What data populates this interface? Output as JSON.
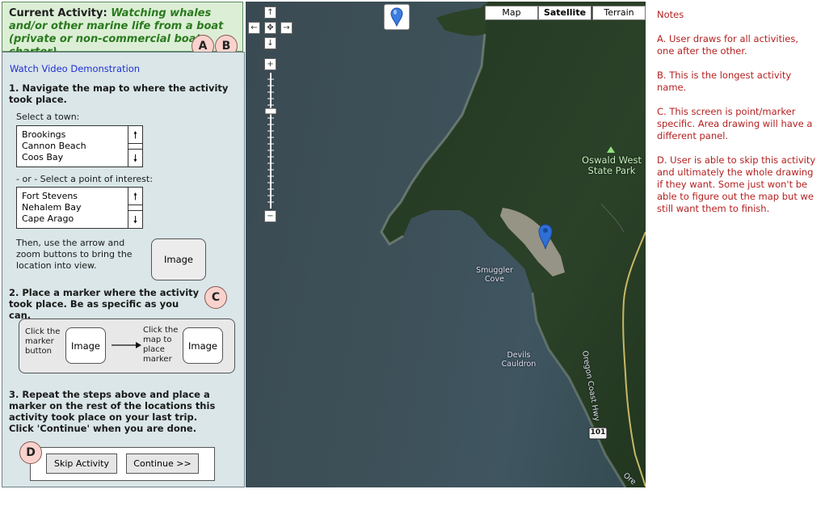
{
  "header": {
    "prefix": "Current Activity:",
    "activity_name": "Watching whales and/or other marine life from a boat (private or non-commercial boat, charter)"
  },
  "badges": {
    "a": "A",
    "b": "B",
    "c": "C",
    "d": "D"
  },
  "panel": {
    "video_link": "Watch Video Demonstration",
    "step1_title": "1. Navigate the map to where the activity took place.",
    "town_label": "Select a town:",
    "towns": [
      "Brookings",
      "Cannon Beach",
      "Coos Bay"
    ],
    "poi_label": "- or - Select a point of interest:",
    "points_of_interest": [
      "Fort Stevens",
      "Nehalem Bay",
      "Cape Arago"
    ],
    "arrow_text": "Then, use the arrow and zoom buttons to bring the location into view.",
    "image_label": "Image",
    "step2_title": "2. Place a marker where the activity took place.  Be as specific as you can.",
    "flow_text_1": "Click the marker button",
    "flow_text_2": "Click the map to place marker",
    "step3_title": "3.  Repeat the steps above and place a marker on the rest of the locations this activity took place on your last trip. Click 'Continue' when you are done.",
    "skip_button": "Skip Activity",
    "continue_button": "Continue >>"
  },
  "map": {
    "types": [
      "Map",
      "Satellite",
      "Terrain"
    ],
    "active_type": "Satellite",
    "nav": {
      "up": "↑",
      "left": "←",
      "center": "✥",
      "right": "→",
      "down": "↓",
      "zoom_in": "+",
      "zoom_out": "−"
    },
    "labels": {
      "park": "Oswald West\nState Park",
      "smuggler": "Smuggler\nCove",
      "devils": "Devils\nCauldron",
      "highway": "Oregon Coast Hwy",
      "route": "101",
      "corner": "Ore"
    },
    "colors": {
      "marker": "#2f6fd6",
      "forest": "#263a25",
      "water": "#3d5058",
      "sand": "#b9b3a6"
    }
  },
  "notes": {
    "title": "Notes",
    "a": "A. User draws for all activities, one after the other.",
    "b": "B. This is the longest activity name.",
    "c": "C. This screen is point/marker specific.  Area drawing will have a different panel.",
    "d": "D. User is able to skip this activity and ultimately the whole drawing if they want. Some just won't be able to figure out the map but we still want them to finish."
  }
}
